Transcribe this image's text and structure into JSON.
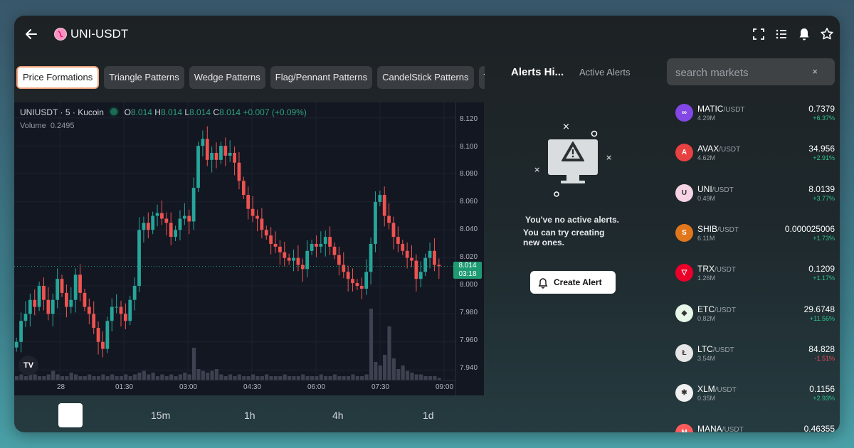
{
  "header": {
    "pair": "UNI-USDT"
  },
  "pattern_tabs": [
    {
      "label": "Price Formations",
      "active": true
    },
    {
      "label": "Triangle Patterns",
      "active": false
    },
    {
      "label": "Wedge Patterns",
      "active": false
    },
    {
      "label": "Flag/Pennant Patterns",
      "active": false
    },
    {
      "label": "CandelStick Patterns",
      "active": false
    },
    {
      "label": "Trendl",
      "active": false
    }
  ],
  "chart": {
    "symbol": "UNIUSDT",
    "interval": "5",
    "exchange": "Kucoin",
    "sep": "·",
    "open_label": "O",
    "open": "8.014",
    "high_label": "H",
    "high": "8.014",
    "low_label": "L",
    "low": "8.014",
    "close_label": "C",
    "close": "8.014",
    "change": "+0.007 (+0.09%)",
    "volume_label": "Volume",
    "volume": "0.2495",
    "current_price": "8.014",
    "countdown": "03:18",
    "logo": "TV",
    "up_color": "#26a69a",
    "down_color": "#ef5350"
  },
  "chart_data": {
    "type": "candlestick",
    "price_ticks": [
      {
        "label": "8.120",
        "value": 8.12
      },
      {
        "label": "8.100",
        "value": 8.1
      },
      {
        "label": "8.080",
        "value": 8.08
      },
      {
        "label": "8.060",
        "value": 8.06
      },
      {
        "label": "8.040",
        "value": 8.04
      },
      {
        "label": "8.020",
        "value": 8.02
      },
      {
        "label": "8.000",
        "value": 8.0
      },
      {
        "label": "7.980",
        "value": 7.98
      },
      {
        "label": "7.960",
        "value": 7.96
      },
      {
        "label": "7.940",
        "value": 7.94
      }
    ],
    "time_ticks": [
      "28",
      "01:30",
      "03:00",
      "04:30",
      "06:00",
      "07:30",
      "09:00"
    ],
    "ylim": [
      7.935,
      8.128
    ],
    "closes": [
      7.96,
      7.975,
      7.98,
      7.99,
      7.985,
      8.0,
      7.99,
      7.98,
      7.99,
      8.005,
      7.995,
      7.985,
      7.99,
      8.008,
      7.995,
      7.985,
      7.98,
      7.97,
      7.96,
      7.955,
      7.975,
      7.985,
      7.985,
      7.98,
      7.975,
      7.99,
      8.0,
      8.04,
      8.045,
      8.04,
      8.05,
      8.052,
      8.048,
      8.045,
      8.035,
      8.04,
      8.048,
      8.05,
      8.046,
      8.07,
      8.1,
      8.105,
      8.09,
      8.095,
      8.09,
      8.1,
      8.093,
      8.095,
      8.088,
      8.075,
      8.065,
      8.055,
      8.05,
      8.048,
      8.04,
      8.036,
      8.03,
      8.028,
      8.024,
      8.02,
      8.018,
      8.02,
      8.015,
      8.012,
      8.025,
      8.03,
      8.028,
      8.03,
      8.035,
      8.028,
      8.022,
      8.015,
      8.01,
      8.005,
      8.002,
      8.0,
      7.998,
      8.01,
      8.03,
      8.06,
      8.065,
      8.05,
      8.045,
      8.035,
      8.03,
      8.025,
      8.02,
      8.018,
      8.005,
      8.01,
      8.02,
      8.025,
      8.015,
      8.014
    ],
    "volumes": [
      2,
      3,
      2,
      4,
      3,
      2,
      2,
      3,
      5,
      3,
      2,
      2,
      4,
      3,
      2,
      2,
      3,
      2,
      2,
      3,
      2,
      3,
      2,
      2,
      3,
      2,
      3,
      4,
      5,
      3,
      4,
      2,
      3,
      2,
      3,
      2,
      3,
      4,
      3,
      18,
      6,
      5,
      4,
      5,
      6,
      3,
      2,
      3,
      2,
      3,
      2,
      2,
      3,
      2,
      2,
      3,
      2,
      2,
      2,
      3,
      2,
      2,
      2,
      3,
      2,
      2,
      2,
      3,
      2,
      2,
      3,
      2,
      2,
      2,
      3,
      2,
      2,
      3,
      40,
      10,
      8,
      14,
      30,
      12,
      6,
      8,
      5,
      4,
      3,
      3,
      2,
      2,
      2,
      1
    ]
  },
  "intervals": [
    "15m",
    "1h",
    "4h",
    "1d"
  ],
  "alerts": {
    "history_tab": "Alerts Hi...",
    "active_tab": "Active Alerts",
    "empty_title": "You've no active alerts.",
    "empty_sub": "You can try creating new ones.",
    "create_button": "Create Alert",
    "illustration_icon": "monitor-warning-icon"
  },
  "search": {
    "placeholder": "search markets",
    "clear": "×"
  },
  "markets": [
    {
      "base": "MATIC",
      "quote": "/USDT",
      "volume": "4.29M",
      "price": "0.7379",
      "change": "+6.37%",
      "up": true,
      "color": "#8247e5",
      "glyph": "∞"
    },
    {
      "base": "AVAX",
      "quote": "/USDT",
      "volume": "4.62M",
      "price": "34.956",
      "change": "+2.91%",
      "up": true,
      "color": "#e84142",
      "glyph": "A"
    },
    {
      "base": "UNI",
      "quote": "/USDT",
      "volume": "0.49M",
      "price": "8.0139",
      "change": "+3.77%",
      "up": true,
      "color": "#f7d3e6",
      "glyph": "U"
    },
    {
      "base": "SHIB",
      "quote": "/USDT",
      "volume": "6.11M",
      "price": "0.000025006",
      "change": "+1.73%",
      "up": true,
      "color": "#e2761b",
      "glyph": "S"
    },
    {
      "base": "TRX",
      "quote": "/USDT",
      "volume": "1.26M",
      "price": "0.1209",
      "change": "+1.17%",
      "up": true,
      "color": "#eb0029",
      "glyph": "▽"
    },
    {
      "base": "ETC",
      "quote": "/USDT",
      "volume": "0.82M",
      "price": "29.6748",
      "change": "+11.56%",
      "up": true,
      "color": "#e8f5e9",
      "glyph": "◆"
    },
    {
      "base": "LTC",
      "quote": "/USDT",
      "volume": "3.54M",
      "price": "84.828",
      "change": "-1.51%",
      "up": false,
      "color": "#e6e6e6",
      "glyph": "Ł"
    },
    {
      "base": "XLM",
      "quote": "/USDT",
      "volume": "0.35M",
      "price": "0.1156",
      "change": "+2.93%",
      "up": true,
      "color": "#f0f0f0",
      "glyph": "✱"
    },
    {
      "base": "MANA",
      "quote": "/USDT",
      "volume": "",
      "price": "0.46355",
      "change": "",
      "up": true,
      "color": "#ff5b5b",
      "glyph": "M"
    }
  ]
}
